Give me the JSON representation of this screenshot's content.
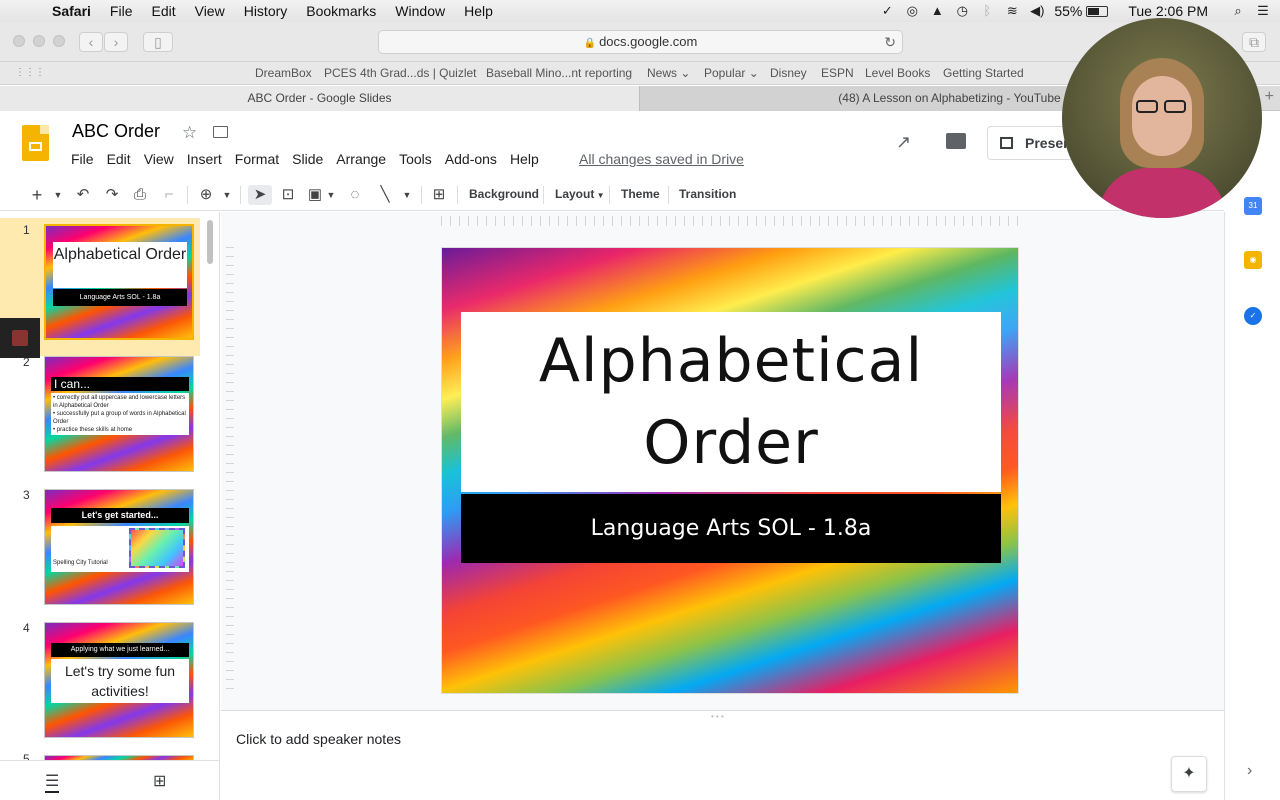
{
  "system_menubar": {
    "app": "Safari",
    "items": [
      "File",
      "Edit",
      "View",
      "History",
      "Bookmarks",
      "Window",
      "Help"
    ],
    "battery": "55%",
    "clock": "Tue 2:06 PM"
  },
  "safari": {
    "url": "docs.google.com",
    "favorites": [
      "DreamBox",
      "PCES 4th Grad...ds | Quizlet",
      "Baseball Mino...nt reporting",
      "News ⌄",
      "Popular ⌄",
      "Disney",
      "ESPN",
      "Level Books",
      "Getting Started"
    ],
    "tabs": [
      {
        "label": "ABC Order - Google Slides",
        "active": true
      },
      {
        "label": "(48) A Lesson on Alphabetizing - YouTube",
        "active": false
      }
    ]
  },
  "slides_app": {
    "doc_title": "ABC Order",
    "menus": [
      "File",
      "Edit",
      "View",
      "Insert",
      "Format",
      "Slide",
      "Arrange",
      "Tools",
      "Add-ons",
      "Help"
    ],
    "save_status": "All changes saved in Drive",
    "present_label": "Present",
    "toolbar": {
      "background": "Background",
      "layout": "Layout",
      "theme": "Theme",
      "transition": "Transition"
    },
    "filmstrip": {
      "selected_index": 1,
      "slides": [
        {
          "number": "1",
          "title": "Alphabetical Order",
          "subtitle": "Language Arts SOL - 1.8a"
        },
        {
          "number": "2",
          "title": "I can...",
          "bullets": [
            "correctly put all uppercase and lowercase letters in Alphabetical Order",
            "successfully put a group of words in Alphabetical Order",
            "practice these skills at home"
          ]
        },
        {
          "number": "3",
          "title": "Let's get started...",
          "caption": "Spelling City Tutorial"
        },
        {
          "number": "4",
          "header": "Applying what we just learned...",
          "title": "Let's try some fun activities!"
        },
        {
          "number": "5"
        }
      ]
    },
    "current_slide": {
      "title_line1": "Alphabetical",
      "title_line2": "Order",
      "subtitle": "Language Arts SOL - 1.8a"
    },
    "speaker_notes_placeholder": "Click to add speaker notes"
  },
  "colors": {
    "slides_yellow": "#f4b400",
    "selection_highlight": "#fde293",
    "canvas_bg": "#f8f9fa"
  }
}
